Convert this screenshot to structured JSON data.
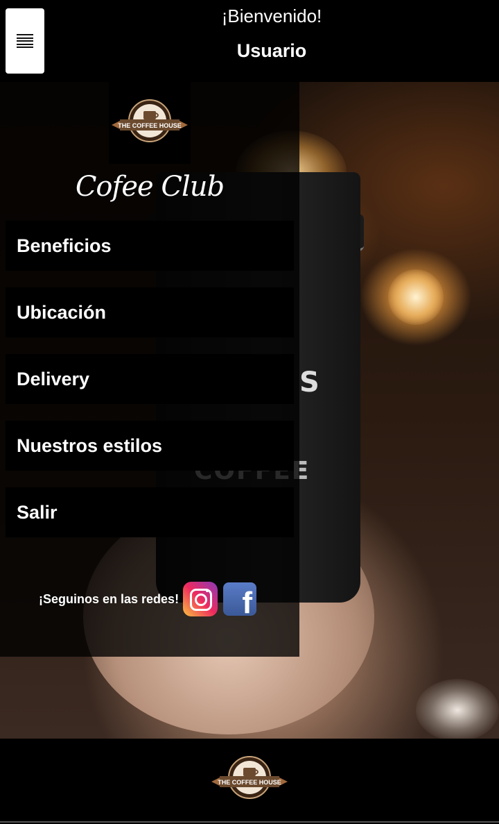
{
  "header": {
    "welcome": "¡Bienvenido!",
    "user": "Usuario"
  },
  "brand": {
    "logo_text": "THE COFFEE HOUSE",
    "club_title": "Cofee Club"
  },
  "menu": {
    "items": [
      {
        "label": "Beneficios"
      },
      {
        "label": "Ubicación"
      },
      {
        "label": "Delivery"
      },
      {
        "label": "Nuestros estilos"
      },
      {
        "label": "Salir"
      }
    ]
  },
  "social": {
    "label": "¡Seguinos en las redes!"
  },
  "colors": {
    "header_bg": "#000000",
    "menu_item_bg": "#000000",
    "logo_brown": "#6b4a2e"
  }
}
